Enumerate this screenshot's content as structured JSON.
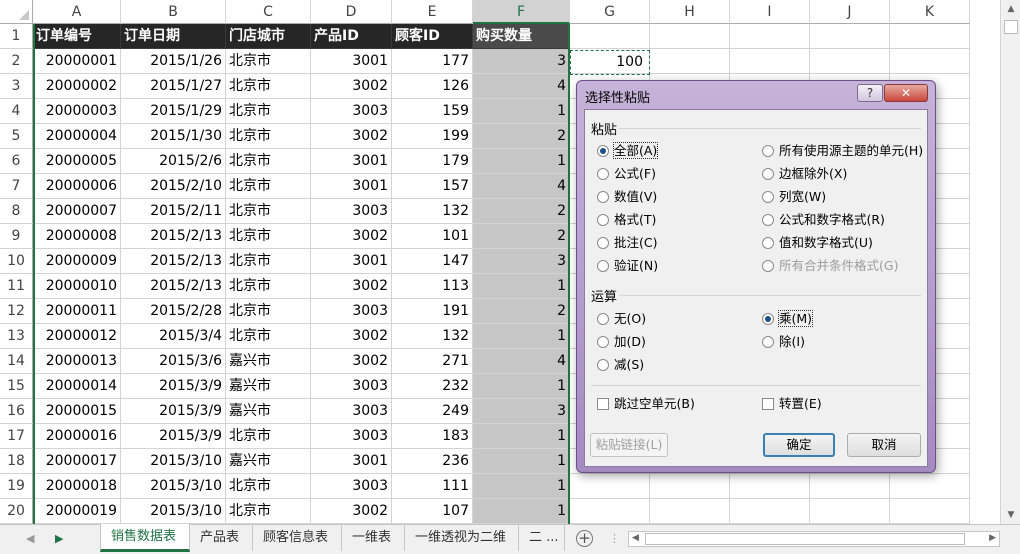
{
  "columns": [
    "A",
    "B",
    "C",
    "D",
    "E",
    "F",
    "G",
    "H",
    "I",
    "J",
    "K"
  ],
  "header_row": [
    "订单编号",
    "订单日期",
    "门店城市",
    "产品ID",
    "顾客ID",
    "购买数量"
  ],
  "rows": [
    [
      "20000001",
      "2015/1/26",
      "北京市",
      "3001",
      "177",
      "3"
    ],
    [
      "20000002",
      "2015/1/27",
      "北京市",
      "3002",
      "126",
      "4"
    ],
    [
      "20000003",
      "2015/1/29",
      "北京市",
      "3003",
      "159",
      "1"
    ],
    [
      "20000004",
      "2015/1/30",
      "北京市",
      "3002",
      "199",
      "2"
    ],
    [
      "20000005",
      "2015/2/6",
      "北京市",
      "3001",
      "179",
      "1"
    ],
    [
      "20000006",
      "2015/2/10",
      "北京市",
      "3001",
      "157",
      "4"
    ],
    [
      "20000007",
      "2015/2/11",
      "北京市",
      "3003",
      "132",
      "2"
    ],
    [
      "20000008",
      "2015/2/13",
      "北京市",
      "3002",
      "101",
      "2"
    ],
    [
      "20000009",
      "2015/2/13",
      "北京市",
      "3001",
      "147",
      "3"
    ],
    [
      "20000010",
      "2015/2/13",
      "北京市",
      "3002",
      "113",
      "1"
    ],
    [
      "20000011",
      "2015/2/28",
      "北京市",
      "3003",
      "191",
      "2"
    ],
    [
      "20000012",
      "2015/3/4",
      "北京市",
      "3002",
      "132",
      "1"
    ],
    [
      "20000013",
      "2015/3/6",
      "嘉兴市",
      "3002",
      "271",
      "4"
    ],
    [
      "20000014",
      "2015/3/9",
      "嘉兴市",
      "3003",
      "232",
      "1"
    ],
    [
      "20000015",
      "2015/3/9",
      "嘉兴市",
      "3003",
      "249",
      "3"
    ],
    [
      "20000016",
      "2015/3/9",
      "北京市",
      "3003",
      "183",
      "1"
    ],
    [
      "20000017",
      "2015/3/10",
      "嘉兴市",
      "3001",
      "236",
      "1"
    ],
    [
      "20000018",
      "2015/3/10",
      "北京市",
      "3003",
      "111",
      "1"
    ],
    [
      "20000019",
      "2015/3/10",
      "北京市",
      "3002",
      "107",
      "1"
    ]
  ],
  "copied_cell_value": "100",
  "sheet_tabs": [
    {
      "label": "销售数据表",
      "active": true
    },
    {
      "label": "产品表",
      "active": false
    },
    {
      "label": "顾客信息表",
      "active": false
    },
    {
      "label": "一维表",
      "active": false
    },
    {
      "label": "一维透视为二维",
      "active": false
    },
    {
      "label": "二 ...",
      "active": false
    }
  ],
  "add_sheet_icon": "+",
  "dialog": {
    "title": "选择性粘贴",
    "help_label": "?",
    "close_label": "✕",
    "paste_group": "粘贴",
    "paste_left": [
      {
        "label": "全部(A)",
        "checked": true,
        "disabled": false
      },
      {
        "label": "公式(F)",
        "checked": false,
        "disabled": false
      },
      {
        "label": "数值(V)",
        "checked": false,
        "disabled": false
      },
      {
        "label": "格式(T)",
        "checked": false,
        "disabled": false
      },
      {
        "label": "批注(C)",
        "checked": false,
        "disabled": false
      },
      {
        "label": "验证(N)",
        "checked": false,
        "disabled": false
      }
    ],
    "paste_right": [
      {
        "label": "所有使用源主题的单元(H)",
        "checked": false,
        "disabled": false
      },
      {
        "label": "边框除外(X)",
        "checked": false,
        "disabled": false
      },
      {
        "label": "列宽(W)",
        "checked": false,
        "disabled": false
      },
      {
        "label": "公式和数字格式(R)",
        "checked": false,
        "disabled": false
      },
      {
        "label": "值和数字格式(U)",
        "checked": false,
        "disabled": false
      },
      {
        "label": "所有合并条件格式(G)",
        "checked": false,
        "disabled": true
      }
    ],
    "operation_group": "运算",
    "op_left": [
      {
        "label": "无(O)",
        "checked": false
      },
      {
        "label": "加(D)",
        "checked": false
      },
      {
        "label": "减(S)",
        "checked": false
      }
    ],
    "op_right": [
      {
        "label": "乘(M)",
        "checked": true
      },
      {
        "label": "除(I)",
        "checked": false
      }
    ],
    "skip_blanks": "跳过空单元(B)",
    "transpose": "转置(E)",
    "paste_link": "粘贴链接(L)",
    "ok": "确定",
    "cancel": "取消"
  }
}
